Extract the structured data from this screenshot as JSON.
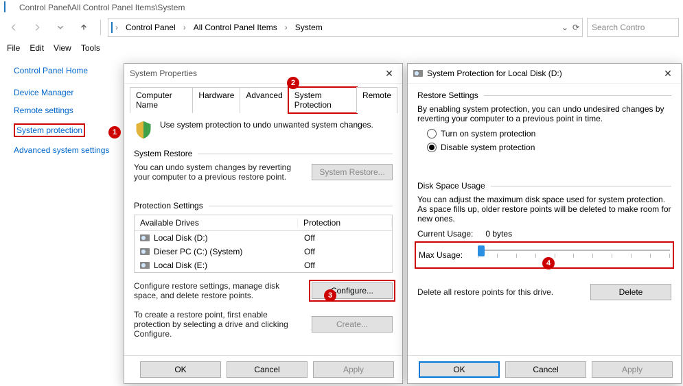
{
  "window": {
    "title": "Control Panel\\All Control Panel Items\\System"
  },
  "breadcrumbs": [
    "Control Panel",
    "All Control Panel Items",
    "System"
  ],
  "search_placeholder": "Search Contro",
  "menubar": [
    "File",
    "Edit",
    "View",
    "Tools"
  ],
  "sidebar": {
    "items": [
      {
        "label": "Control Panel Home"
      },
      {
        "label": "Device Manager"
      },
      {
        "label": "Remote settings"
      },
      {
        "label": "System protection",
        "highlight": true
      },
      {
        "label": "Advanced system settings"
      }
    ]
  },
  "badges": {
    "b1": "1",
    "b2": "2",
    "b3": "3",
    "b4": "4"
  },
  "dlg1": {
    "title": "System Properties",
    "tabs": [
      "Computer Name",
      "Hardware",
      "Advanced",
      "System Protection",
      "Remote"
    ],
    "active_tab_index": 3,
    "intro": "Use system protection to undo unwanted system changes.",
    "restore_group": "System Restore",
    "restore_desc": "You can undo system changes by reverting your computer to a previous restore point.",
    "restore_btn": "System Restore...",
    "protection_group": "Protection Settings",
    "drives_header": {
      "c1": "Available Drives",
      "c2": "Protection"
    },
    "drives": [
      {
        "name": "Local Disk (D:)",
        "prot": "Off"
      },
      {
        "name": "Dieser PC (C:) (System)",
        "prot": "Off"
      },
      {
        "name": "Local Disk (E:)",
        "prot": "Off"
      }
    ],
    "configure_desc": "Configure restore settings, manage disk space, and delete restore points.",
    "configure_btn": "Configure...",
    "create_desc": "To create a restore point, first enable protection by selecting a drive and clicking Configure.",
    "create_btn": "Create...",
    "ok": "OK",
    "cancel": "Cancel",
    "apply": "Apply"
  },
  "dlg2": {
    "title": "System Protection for Local Disk (D:)",
    "restore_group": "Restore Settings",
    "restore_desc": "By enabling system protection, you can undo undesired changes by reverting your computer to a previous point in time.",
    "radio_on": "Turn on system protection",
    "radio_off": "Disable system protection",
    "disk_group": "Disk Space Usage",
    "disk_desc": "You can adjust the maximum disk space used for system protection. As space fills up, older restore points will be deleted to make room for new ones.",
    "current_label": "Current Usage:",
    "current_value": "0 bytes",
    "max_label": "Max Usage:",
    "delete_desc": "Delete all restore points for this drive.",
    "delete_btn": "Delete",
    "ok": "OK",
    "cancel": "Cancel",
    "apply": "Apply"
  }
}
